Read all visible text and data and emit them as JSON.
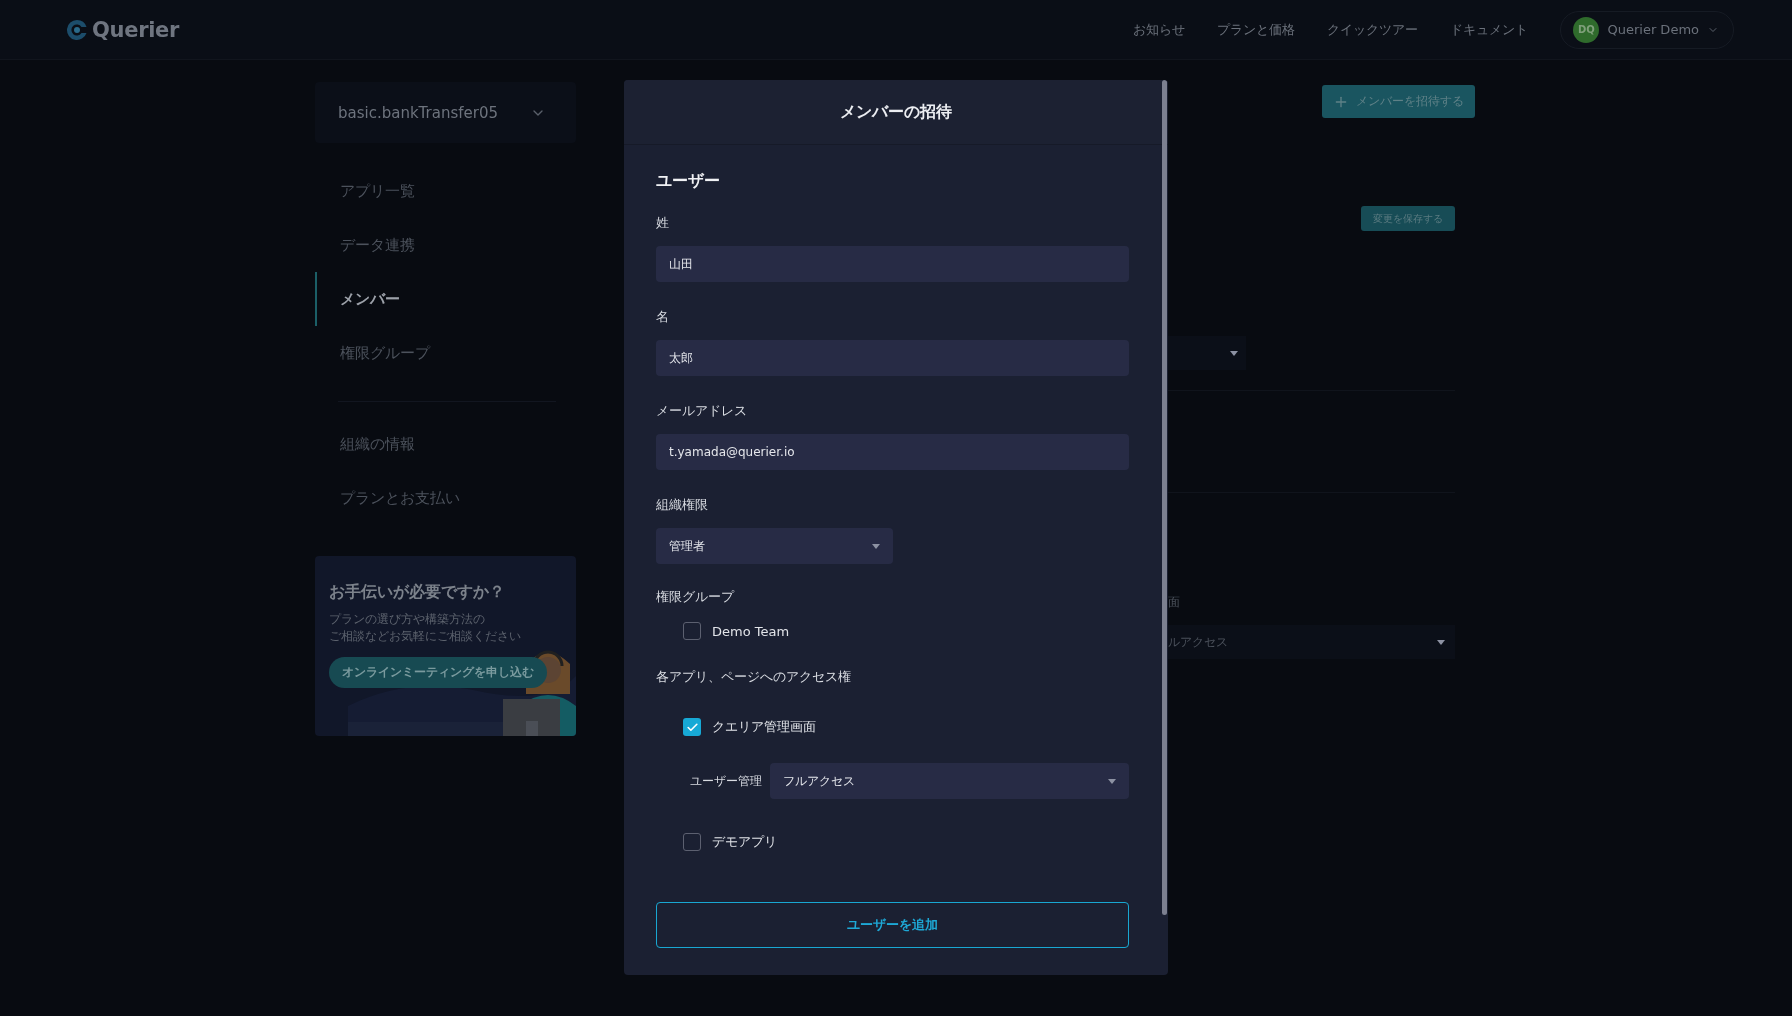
{
  "header": {
    "logo": "Querier",
    "nav": [
      "お知らせ",
      "プランと価格",
      "クイックツアー",
      "ドキュメント"
    ],
    "account": {
      "initials": "DQ",
      "name": "Querier Demo"
    }
  },
  "sidebar": {
    "app_select": "basic.bankTransfer05",
    "items": [
      {
        "label": "アプリ一覧",
        "selected": false
      },
      {
        "label": "データ連携",
        "selected": false
      },
      {
        "label": "メンバー",
        "selected": true
      },
      {
        "label": "権限グループ",
        "selected": false
      }
    ],
    "settings_items": [
      {
        "label": "組織の情報",
        "selected": false
      },
      {
        "label": "プランとお支払い",
        "selected": false
      }
    ],
    "help_card": {
      "title": "お手伝いが必要ですか？",
      "text": [
        "プランの選び方や構築方法の",
        "ご相談などお気軽にご相談ください"
      ],
      "button": "オンラインミーティングを申し込む"
    }
  },
  "main": {
    "invite_button": "メンバーを招待する",
    "save_button": "変更を保存する",
    "label_fragment": "面",
    "select_fragment": "ルアクセス"
  },
  "modal": {
    "title": "メンバーの招待",
    "section": "ユーザー",
    "fields": [
      {
        "label": "姓",
        "value": "山田",
        "kind": "text"
      },
      {
        "label": "名",
        "value": "太郎",
        "kind": "text"
      },
      {
        "label": "メールアドレス",
        "value": "t.yamada@querier.io",
        "kind": "text"
      },
      {
        "label": "組織権限",
        "value": "管理者",
        "kind": "select"
      }
    ],
    "group_label": "権限グループ",
    "groups": [
      {
        "label": "Demo Team",
        "checked": false
      }
    ],
    "access_label": "各アプリ、ページへのアクセス権",
    "apps": [
      {
        "label": "クエリア管理画面",
        "checked": true,
        "permissions": [
          {
            "label": "ユーザー管理",
            "value": "フルアクセス"
          }
        ]
      },
      {
        "label": "デモアプリ",
        "checked": false
      }
    ],
    "submit": "ユーザーを追加"
  }
}
